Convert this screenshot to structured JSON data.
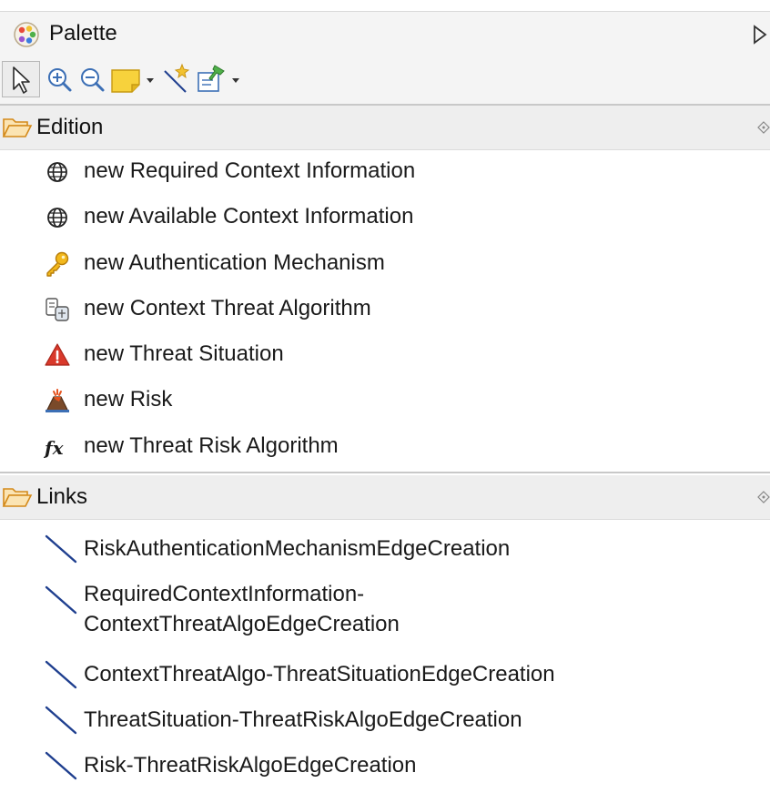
{
  "palette": {
    "title": "Palette"
  },
  "toolbar": {
    "tools": [
      {
        "icon": "arrow-select-icon"
      },
      {
        "icon": "zoom-in-icon"
      },
      {
        "icon": "zoom-out-icon"
      },
      {
        "icon": "note-icon"
      },
      {
        "icon": "connection-icon"
      },
      {
        "icon": "pin-note-icon"
      }
    ]
  },
  "edition": {
    "label": "Edition",
    "items": [
      {
        "label": "new Required Context Information",
        "icon": "globe-icon"
      },
      {
        "label": "new Available Context Information",
        "icon": "globe-icon"
      },
      {
        "label": "new Authentication Mechanism",
        "icon": "key-icon"
      },
      {
        "label": "new Context Threat Algorithm",
        "icon": "algorithm-icon"
      },
      {
        "label": "new Threat Situation",
        "icon": "warning-icon"
      },
      {
        "label": "new Risk",
        "icon": "volcano-icon"
      },
      {
        "label": "new Threat Risk Algorithm",
        "icon": "function-icon"
      }
    ]
  },
  "links": {
    "label": "Links",
    "items": [
      {
        "label": "RiskAuthenticationMechanismEdgeCreation",
        "icon": "edge-line-icon"
      },
      {
        "label_line1": "RequiredContextInformation-",
        "label_line2": "ContextThreatAlgoEdgeCreation",
        "icon": "edge-line-icon"
      },
      {
        "label": "ContextThreatAlgo-ThreatSituationEdgeCreation",
        "icon": "edge-line-icon"
      },
      {
        "label": "ThreatSituation-ThreatRiskAlgoEdgeCreation",
        "icon": "edge-line-icon"
      },
      {
        "label": "Risk-ThreatRiskAlgoEdgeCreation",
        "icon": "edge-line-icon"
      }
    ]
  },
  "colors": {
    "header_bg": "#f4f4f4",
    "section_bg": "#eeeeee",
    "folder": "#e8a33a",
    "warning": "#d9392b",
    "edge_line": "#1f3f8f"
  }
}
